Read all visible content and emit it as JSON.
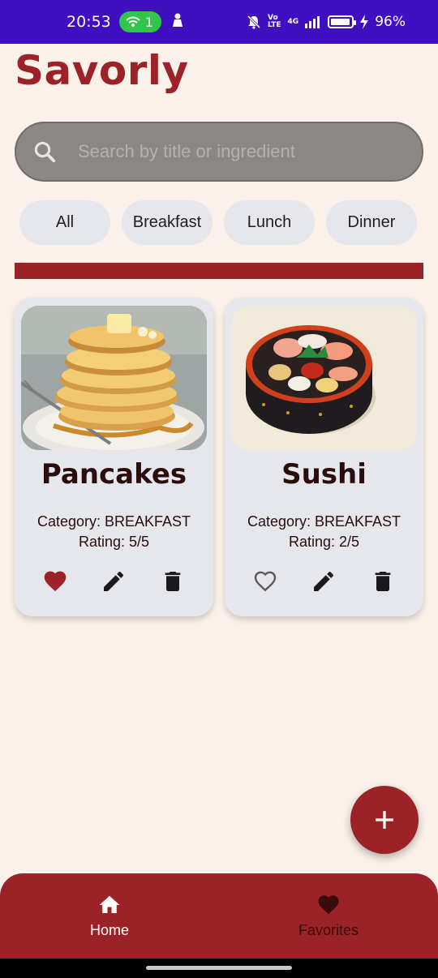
{
  "status_bar": {
    "time": "20:53",
    "hotspot_count": "1",
    "volte": "Vo",
    "lte": "LTE",
    "network": "4G",
    "battery_percent": "96%",
    "battery_level": 0.96
  },
  "app": {
    "title": "Savorly"
  },
  "search": {
    "placeholder": "Search by title or ingredient"
  },
  "filters": [
    {
      "label": "All"
    },
    {
      "label": "Breakfast"
    },
    {
      "label": "Lunch"
    },
    {
      "label": "Dinner"
    }
  ],
  "recipes": [
    {
      "title": "Pancakes",
      "category": "Category: BREAKFAST",
      "rating": "Rating: 5/5",
      "favorite": true,
      "image": "pancakes-photo"
    },
    {
      "title": "Sushi",
      "category": "Category: BREAKFAST",
      "rating": "Rating: 2/5",
      "favorite": false,
      "image": "sushi-illustration"
    }
  ],
  "bottom_nav": {
    "home_label": "Home",
    "favorites_label": "Favorites"
  },
  "colors": {
    "brand": "#9b2226",
    "background": "#fbf1ea",
    "card": "#e6e7ec",
    "status_bar": "#3f0fc0"
  },
  "icons": {
    "search": "search-icon",
    "favorite_filled": "heart-filled-icon",
    "favorite_outline": "heart-outline-icon",
    "edit": "pencil-icon",
    "delete": "trash-icon",
    "add": "plus-icon",
    "home": "home-icon",
    "favorites": "heart-icon"
  }
}
